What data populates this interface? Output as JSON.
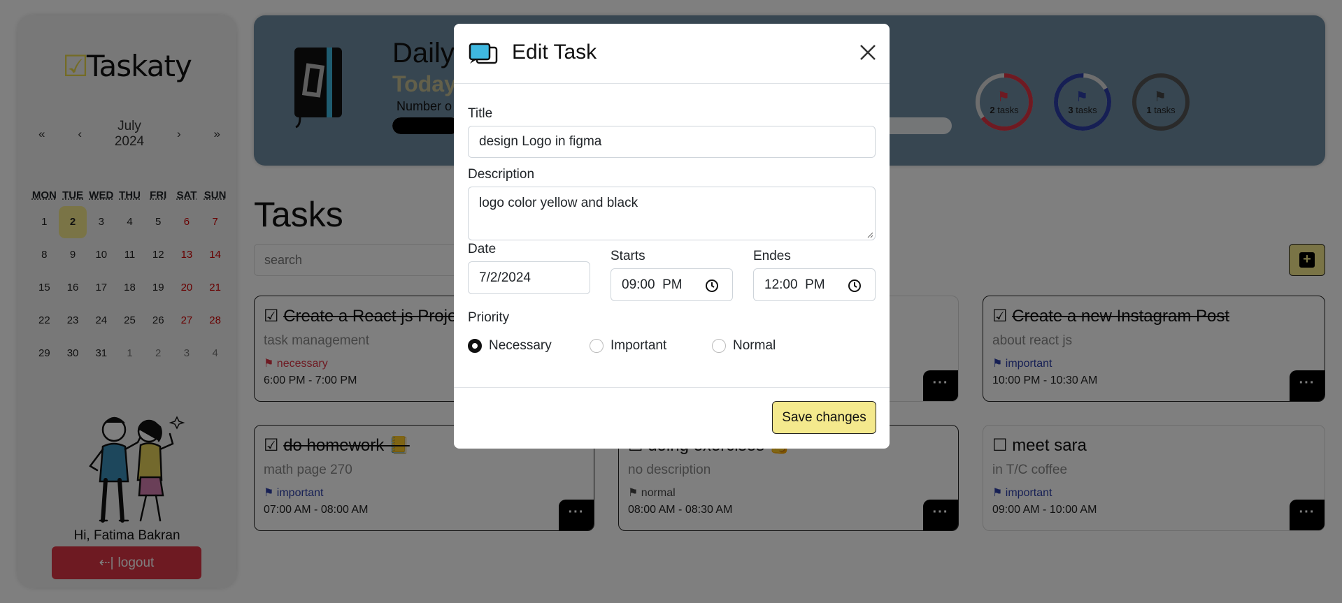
{
  "app": {
    "logo_text": "Taskaty",
    "logo_icon": "check-square-icon"
  },
  "calendar": {
    "nav": {
      "first": "«",
      "prev": "‹",
      "next": "›",
      "last": "»",
      "month": "July",
      "year": "2024"
    },
    "day_headers": [
      "MON",
      "TUE",
      "WED",
      "THU",
      "FRI",
      "SAT",
      "SUN"
    ],
    "weeks": [
      [
        "1",
        "2",
        "3",
        "4",
        "5",
        "6",
        "7"
      ],
      [
        "8",
        "9",
        "10",
        "11",
        "12",
        "13",
        "14"
      ],
      [
        "15",
        "16",
        "17",
        "18",
        "19",
        "20",
        "21"
      ],
      [
        "22",
        "23",
        "24",
        "25",
        "26",
        "27",
        "28"
      ],
      [
        "29",
        "30",
        "31",
        "1",
        "2",
        "3",
        "4"
      ]
    ],
    "today": "2"
  },
  "user": {
    "greeting": "Hi, Fatima Bakran"
  },
  "logout": {
    "icon": "logout-arrow-icon",
    "label": "logout"
  },
  "banner": {
    "title": "Daily",
    "subtitle": "Today",
    "progress_label": "Number o",
    "progress_fraction": 0.12,
    "priority_stats": [
      {
        "count": "2",
        "unit": "tasks",
        "color": "#dc3545",
        "flag": "flag-red-icon"
      },
      {
        "count": "3",
        "unit": "tasks",
        "color": "#2c3fa8",
        "flag": "flag-blue-icon"
      },
      {
        "count": "1",
        "unit": "tasks",
        "color": "#555555",
        "flag": "flag-gray-icon"
      }
    ]
  },
  "tasks": {
    "heading": "Tasks",
    "search_placeholder": "search",
    "add_icon": "plus-square-icon",
    "cards": [
      {
        "checkbox": "☑",
        "title": "Create a React js Project",
        "done": true,
        "description": "task management",
        "priority": "necessary",
        "priority_color": "#dc3545",
        "time": "6:00 PM - 7:00 PM"
      },
      {
        "checkbox": "☑",
        "title": "Create a new Instagram Post",
        "done": true,
        "description": "about react js",
        "priority": "important",
        "priority_color": "#2c3fa8",
        "time": "10:00 PM - 10:30 AM"
      },
      {
        "checkbox": "☑",
        "title": "do homework 📒",
        "done": true,
        "description": "math page 270",
        "priority": "important",
        "priority_color": "#2c3fa8",
        "time": "07:00 AM - 08:00 AM"
      },
      {
        "checkbox": "☐",
        "title": "doing exercises 💪",
        "done": false,
        "description": "no description",
        "priority": "normal",
        "priority_color": "#444444",
        "time": "08:00 AM - 08:30 AM"
      },
      {
        "checkbox": "☐",
        "title": "meet sara",
        "done": false,
        "description": "in T/C coffee",
        "priority": "important",
        "priority_color": "#2c3fa8",
        "time": "09:00 AM - 10:00 AM"
      }
    ],
    "more_label": "···"
  },
  "modal": {
    "title": "Edit Task",
    "title_label": "Title",
    "title_value": "design Logo in figma",
    "description_label": "Description",
    "description_value": "logo color yellow and black",
    "date_label": "Date",
    "date_value": "7/2/2024",
    "starts_label": "Starts",
    "starts_value": "09:00  PM",
    "ends_label": "Endes",
    "ends_value": "12:00  PM",
    "priority_label": "Priority",
    "priority_options": [
      "Necessary",
      "Important",
      "Normal"
    ],
    "priority_selected": "Necessary",
    "save_label": "Save changes"
  }
}
